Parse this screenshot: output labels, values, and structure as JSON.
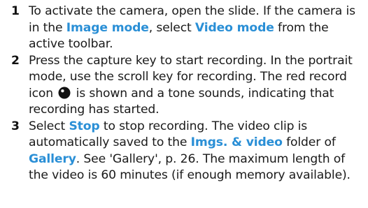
{
  "colors": {
    "text": "#1a1a1a",
    "highlight": "#2a8fd6"
  },
  "steps": [
    {
      "number": "1",
      "t1": "To activate the camera, open the slide. If the camera is in the ",
      "h1": "Image mode",
      "t2": ", select ",
      "h2": "Video mode",
      "t3": " from the active toolbar."
    },
    {
      "number": "2",
      "t1": "Press the capture key to start recording. In the portrait mode, use the scroll key for recording. The red record icon ",
      "icon": "record-icon",
      "t2": " is shown and a tone sounds, indicating that recording has started."
    },
    {
      "number": "3",
      "t1": "Select ",
      "h1": "Stop",
      "t2": " to stop recording. The video clip is automatically saved to the ",
      "h2": "Imgs. & video",
      "t3": " folder of ",
      "h3": "Gallery",
      "t4": ". See 'Gallery', p. 26. The maximum length of the video is 60 minutes (if enough memory available)."
    }
  ]
}
